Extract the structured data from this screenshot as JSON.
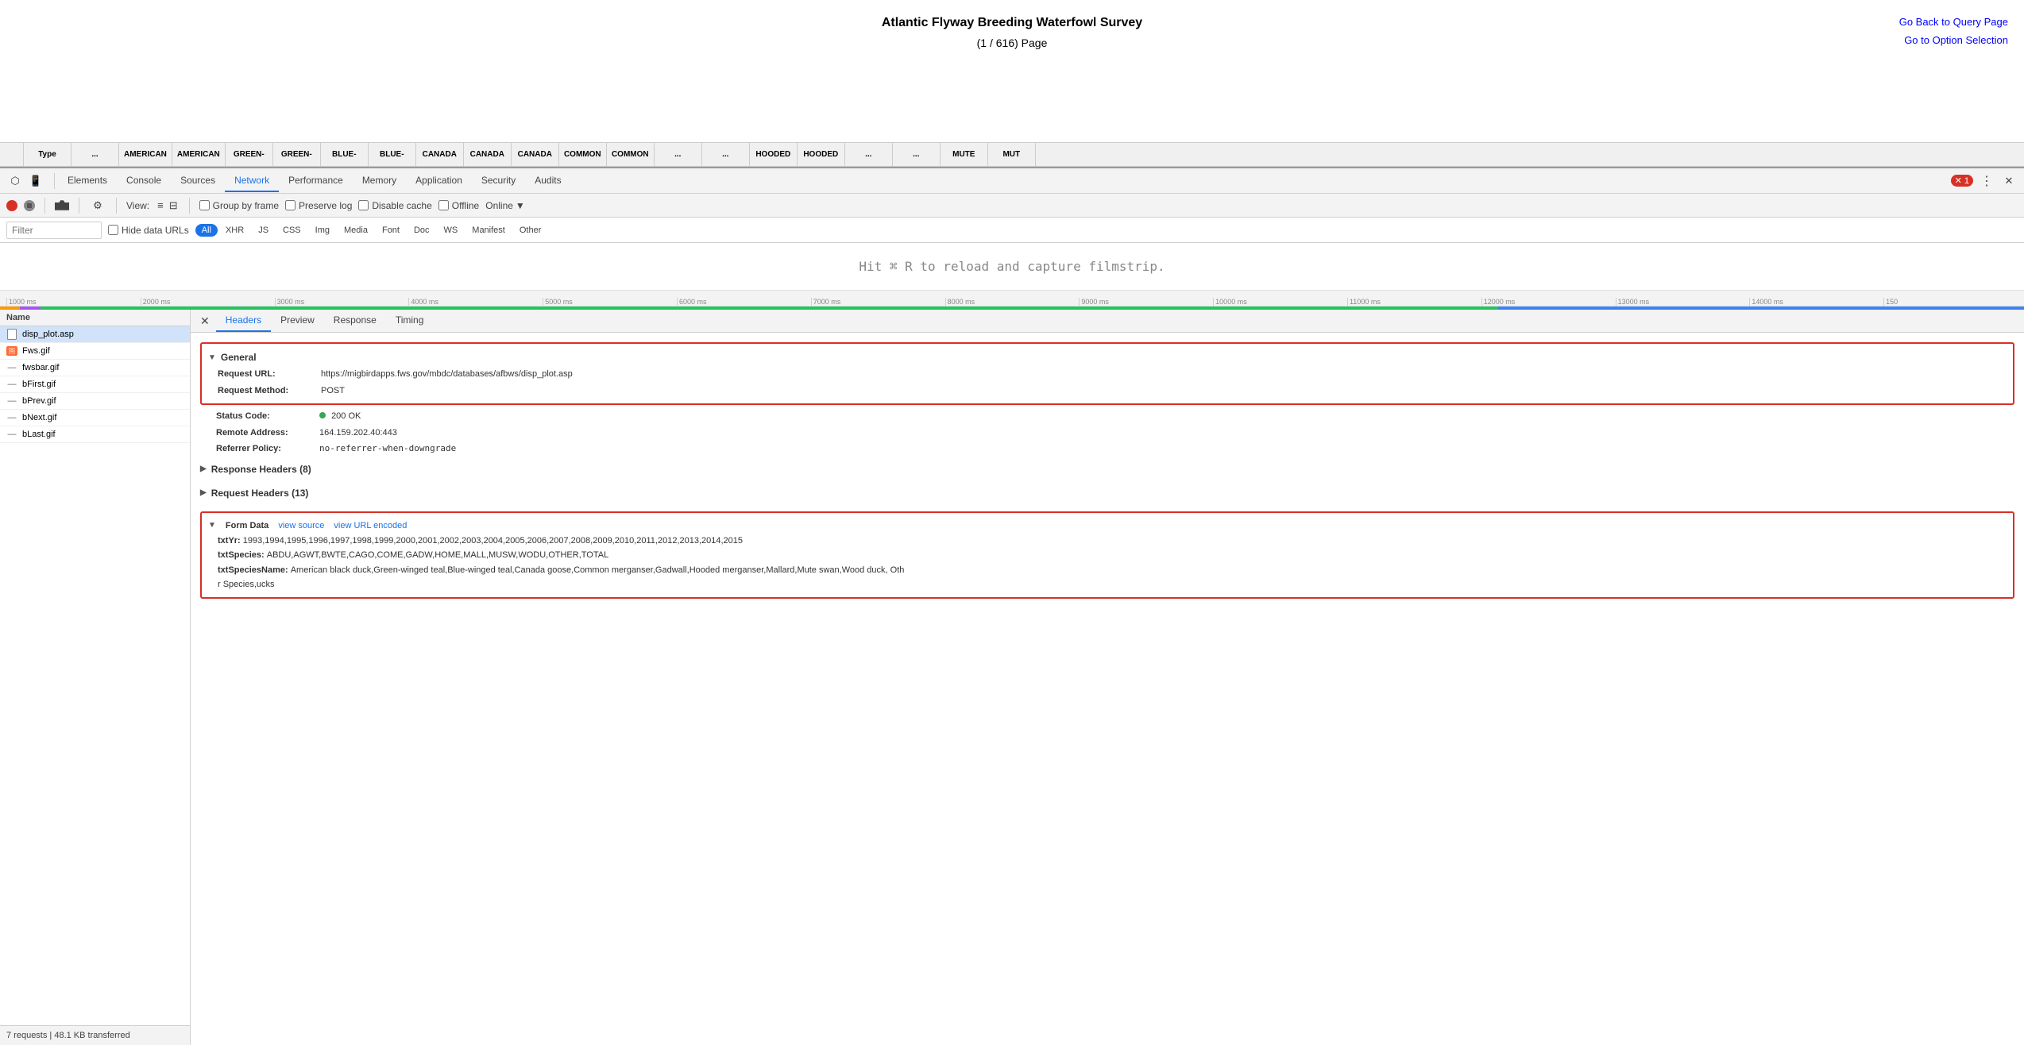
{
  "page": {
    "title": "Atlantic Flyway Breeding Waterfowl Survey",
    "subtitle": "(1 / 616) Page",
    "link_back": "Go Back to Query Page",
    "link_options": "Go to Option Selection"
  },
  "table_headers": [
    "",
    "Type",
    "...",
    "AMERICAN",
    "AMERICAN",
    "GREEN-",
    "GREEN-",
    "BLUE-",
    "BLUE-",
    "CANADA",
    "CANADA",
    "CANADA",
    "COMMON",
    "COMMON",
    "...",
    "...",
    "HOODED",
    "HOODED",
    "...",
    "...",
    "MUTE",
    "MUT"
  ],
  "devtools": {
    "tabs": [
      "Elements",
      "Console",
      "Sources",
      "Network",
      "Performance",
      "Memory",
      "Application",
      "Security",
      "Audits"
    ],
    "active_tab": "Network",
    "error_count": "1",
    "network": {
      "toolbar": {
        "view_label": "View:",
        "group_by_frame": "Group by frame",
        "preserve_log": "Preserve log",
        "disable_cache": "Disable cache",
        "offline": "Offline",
        "online_label": "Online"
      },
      "filter_placeholder": "Filter",
      "hide_data_urls": "Hide data URLs",
      "filter_chips": [
        "All",
        "XHR",
        "JS",
        "CSS",
        "Img",
        "Media",
        "Font",
        "Doc",
        "WS",
        "Manifest",
        "Other"
      ],
      "active_chip": "All",
      "filmstrip_msg": "Hit ⌘ R to reload and capture filmstrip.",
      "timeline_labels": [
        "1000 ms",
        "2000 ms",
        "3000 ms",
        "4000 ms",
        "5000 ms",
        "6000 ms",
        "7000 ms",
        "8000 ms",
        "9000 ms",
        "10000 ms",
        "11000 ms",
        "12000 ms",
        "13000 ms",
        "14000 ms",
        "150"
      ]
    },
    "requests": {
      "header": "Name",
      "items": [
        {
          "name": "disp_plot.asp",
          "icon": "page",
          "selected": true
        },
        {
          "name": "Fws.gif",
          "icon": "gif"
        },
        {
          "name": "fwsbar.gif",
          "icon": "gif-minus"
        },
        {
          "name": "bFirst.gif",
          "icon": "gif-minus"
        },
        {
          "name": "bPrev.gif",
          "icon": "gif-minus"
        },
        {
          "name": "bNext.gif",
          "icon": "gif-minus"
        },
        {
          "name": "bLast.gif",
          "icon": "gif-minus"
        }
      ],
      "footer": "7 requests  |  48.1 KB transferred"
    },
    "details": {
      "tabs": [
        "Headers",
        "Preview",
        "Response",
        "Timing"
      ],
      "active_tab": "Headers",
      "general_section": {
        "title": "General",
        "request_url": "https://migbirdapps.fws.gov/mbdc/databases/afbws/disp_plot.asp",
        "request_method": "POST",
        "status_code": "200  OK",
        "remote_address": "164.159.202.40:443",
        "referrer_policy": "no-referrer-when-downgrade"
      },
      "response_headers_section": {
        "title": "Response Headers (8)"
      },
      "request_headers_section": {
        "title": "Request Headers (13)"
      },
      "form_data_section": {
        "title": "Form Data",
        "view_source": "view source",
        "view_url_encoded": "view URL encoded",
        "txtYr": "1993,1994,1995,1996,1997,1998,1999,2000,2001,2002,2003,2004,2005,2006,2007,2008,2009,2010,2011,2012,2013,2014,2015",
        "txtSpecies": "ABDU,AGWT,BWTE,CAGO,COME,GADW,HOME,MALL,MUSW,WODU,OTHER,TOTAL",
        "txtSpeciesName": "American black duck,Green-winged teal,Blue-winged teal,Canada goose,Common merganser,Gadwall,Hooded merganser,Mallard,Mute swan,Wood duck, Oth",
        "r_species_ucks": "r Species,ucks"
      }
    }
  }
}
